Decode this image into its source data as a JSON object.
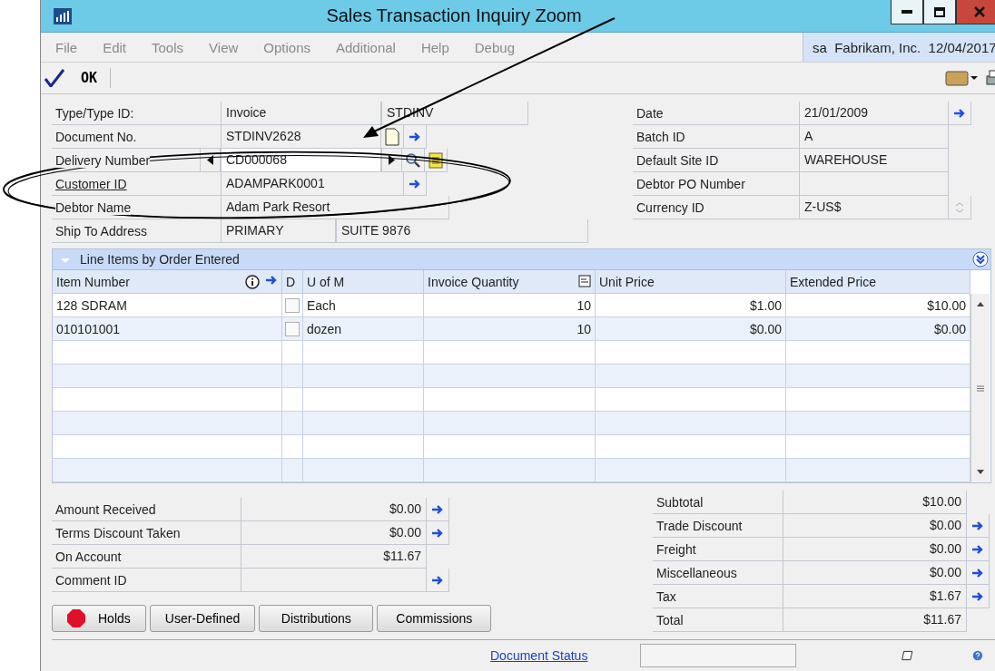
{
  "window": {
    "title": "Sales Transaction Inquiry Zoom"
  },
  "menu": [
    {
      "label": "File"
    },
    {
      "label": "Edit"
    },
    {
      "label": "Tools"
    },
    {
      "label": "View"
    },
    {
      "label": "Options"
    },
    {
      "label": "Additional"
    },
    {
      "label": "Help"
    },
    {
      "label": "Debug"
    }
  ],
  "company_info": "sa  Fabrikam, Inc.  12/04/2017",
  "toolbar": {
    "ok_label": "OK"
  },
  "header_left": [
    {
      "label": "Type/Type ID:",
      "kind": "pair",
      "values": [
        "Invoice",
        "STDINV"
      ]
    },
    {
      "label": "Document No.",
      "kind": "document",
      "value": "STDINV2628"
    },
    {
      "label": "Delivery Number",
      "kind": "browse",
      "value": "CD000068"
    },
    {
      "label": "Customer ID",
      "kind": "link",
      "value": "ADAMPARK0001"
    },
    {
      "label": "Debtor Name",
      "kind": "wide",
      "value": "Adam Park Resort"
    },
    {
      "label": "Ship To Address",
      "kind": "address",
      "values": [
        "PRIMARY",
        "SUITE 9876"
      ]
    }
  ],
  "header_right": [
    {
      "label": "Date",
      "kind": "lookup",
      "value": "21/01/2009"
    },
    {
      "label": "Batch ID",
      "kind": "plain",
      "value": "A"
    },
    {
      "label": "Default Site ID",
      "kind": "plain",
      "value": "WAREHOUSE"
    },
    {
      "label": "Debtor PO Number",
      "kind": "plain"
    },
    {
      "label": "Currency ID",
      "kind": "spinner",
      "value": "Z-US$"
    }
  ],
  "line_items": {
    "title": "Line Items by Order Entered",
    "columns": [
      "Item Number",
      "D",
      "U of M",
      "Invoice Quantity",
      "Unit Price",
      "Extended Price"
    ],
    "rows": [
      {
        "item_number": "128 SDRAM",
        "d_checked": false,
        "u_of_m": "Each",
        "invoice_quantity": "10",
        "unit_price": "$1.00",
        "extended_price": "$10.00"
      },
      {
        "item_number": "010101001",
        "d_checked": false,
        "u_of_m": "dozen",
        "invoice_quantity": "10",
        "unit_price": "$0.00",
        "extended_price": "$0.00"
      }
    ]
  },
  "totals_left": [
    {
      "label": "Amount Received",
      "kind": "lookup",
      "value": "$0.00"
    },
    {
      "label": "Terms Discount Taken",
      "kind": "lookup",
      "value": "$0.00"
    },
    {
      "label": "On Account",
      "kind": "plain",
      "value": "$11.67"
    },
    {
      "label": "Comment ID",
      "kind": "lookup"
    }
  ],
  "buttons": [
    {
      "label": "Holds",
      "kind": "holds"
    },
    {
      "label": "User-Defined",
      "kind": "plain"
    },
    {
      "label": "Distributions",
      "kind": "plain"
    },
    {
      "label": "Commissions",
      "kind": "plain"
    }
  ],
  "totals_right": [
    {
      "label": "Subtotal",
      "kind": "plain",
      "value": "$10.00"
    },
    {
      "label": "Trade Discount",
      "kind": "lookup",
      "value": "$0.00"
    },
    {
      "label": "Freight",
      "kind": "lookup",
      "value": "$0.00"
    },
    {
      "label": "Miscellaneous",
      "kind": "lookup",
      "value": "$0.00"
    },
    {
      "label": "Tax",
      "kind": "lookup",
      "value": "$1.67"
    },
    {
      "label": "Total",
      "kind": "plain",
      "value": "$11.67"
    }
  ],
  "status_bar": {
    "link": "Document Status"
  }
}
